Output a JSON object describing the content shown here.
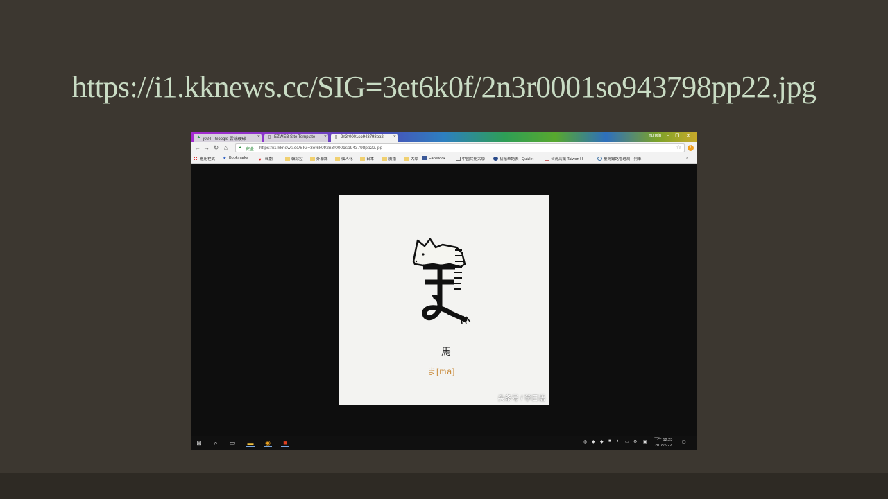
{
  "slide": {
    "title": "https://i1.kknews.cc/SIG=3et6k0f/2n3r0001so943798pp22.jpg"
  },
  "browser": {
    "tabs": [
      {
        "label": "j024 - Google 雲端硬碟",
        "icon": "drive-icon"
      },
      {
        "label": "EZWEB Site Template",
        "icon": "page-icon"
      },
      {
        "label": "2n3r0001so943798pp2",
        "icon": "page-icon"
      }
    ],
    "window_user": "Yunxin",
    "address": {
      "secure_label": "安全",
      "url": "https://i1.kknews.cc/SIG=3et6k0f/2n3r0001so943798pp22.jpg"
    },
    "bookmarks": [
      "應用程式",
      "Bookmarks",
      "韓劇",
      "韓綜控",
      "外聯課",
      "個人化",
      "日本",
      "廣播",
      "大學",
      "Facebook",
      "中國文化大學",
      "初階華語表 | Quizlet",
      "台灣高鐵 Taiwan H",
      "臺灣鐵路管理局 - 列車"
    ]
  },
  "image": {
    "character": "馬",
    "kana": "ま[ma]",
    "watermark": "头条号 / 学日语"
  },
  "taskbar": {
    "clock_period_time": "下午 12:23",
    "clock_date": "2018/5/22"
  },
  "colors": {
    "slide_bg": "#3c3730",
    "title": "#c9dcc4",
    "kana": "#c98a3a"
  }
}
